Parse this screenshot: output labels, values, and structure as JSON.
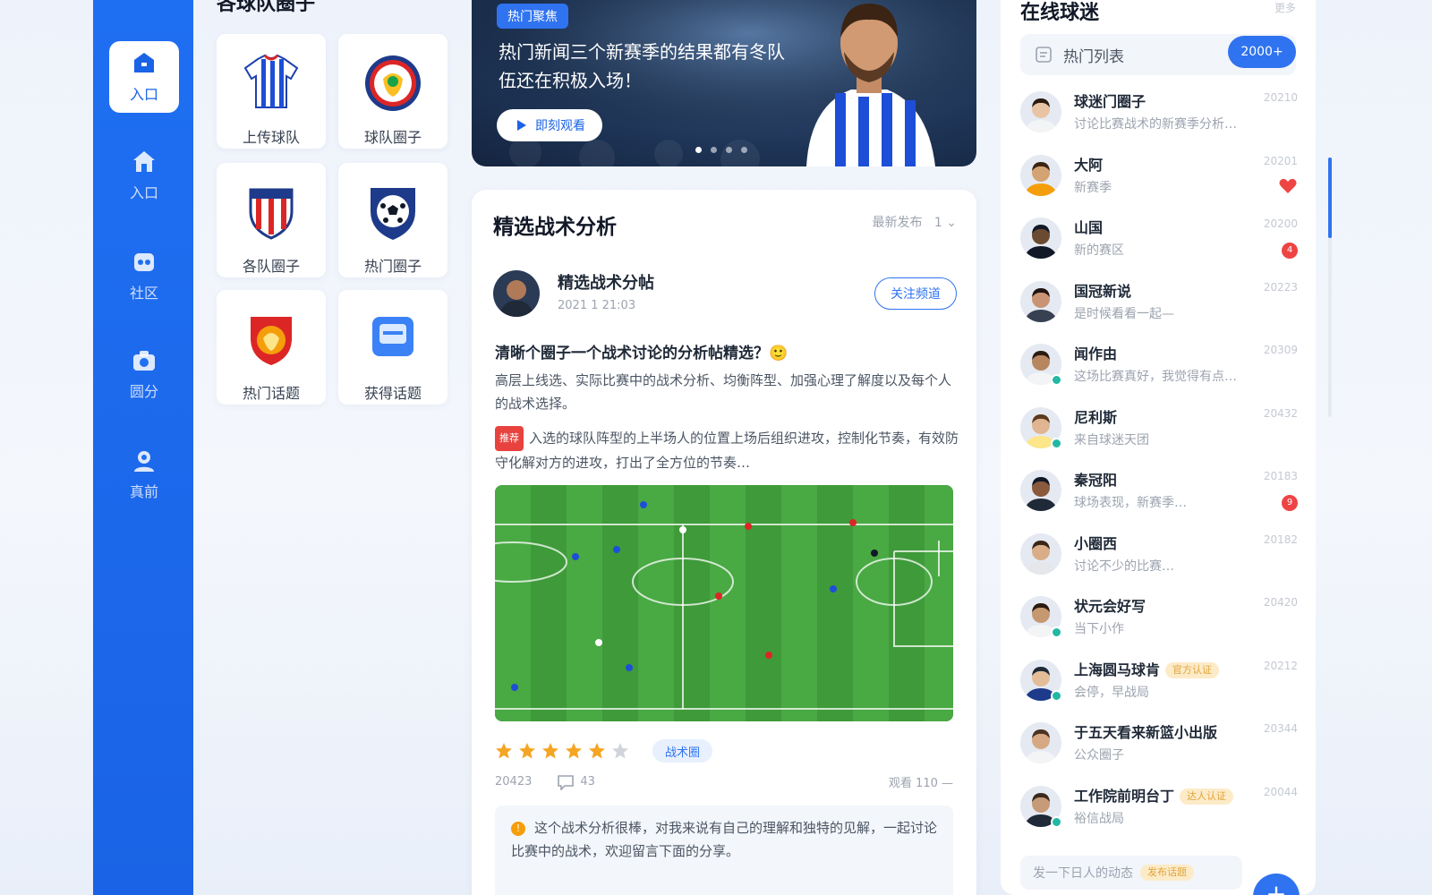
{
  "sidebar": {
    "items": [
      {
        "label": "入口",
        "icon": "home-badge-icon",
        "active": true
      },
      {
        "label": "入口",
        "icon": "house-icon",
        "active": false
      },
      {
        "label": "社区",
        "icon": "community-icon",
        "active": false
      },
      {
        "label": "圆分",
        "icon": "camera-icon",
        "active": false
      },
      {
        "label": "真前",
        "icon": "user-icon",
        "active": false
      }
    ]
  },
  "circles": {
    "title": "各球队圈子",
    "items": [
      {
        "label": "上传球队",
        "icon": "jersey-icon"
      },
      {
        "label": "球队圈子",
        "icon": "club-badge-icon"
      },
      {
        "label": "各队圈子",
        "icon": "crest-icon"
      },
      {
        "label": "热门圈子",
        "icon": "ball-shield-icon"
      },
      {
        "label": "热门话题",
        "icon": "trophy-badge-icon"
      },
      {
        "label": "获得话题",
        "icon": "chat-icon"
      }
    ]
  },
  "banner": {
    "tag": "热门聚焦",
    "text": "热门新闻三个新赛季的结果都有冬队伍还在积极入场！",
    "button": "即刻观看",
    "dots": 4,
    "active_dot": 0
  },
  "feed": {
    "title": "精选战术分析",
    "sort": "最新发布",
    "sort_value": "1",
    "post": {
      "author": "精选战术分帖",
      "time": "2021 1 21:03",
      "follow": "关注频道",
      "headline": "清晰个圈子一个战术讨论的分析帖精选？🙂",
      "body": "高层上线选、实际比赛中的战术分析、均衡阵型、加强心理了解度以及每个人的战术选择。",
      "quote_badge": "推荐",
      "quote": "入选的球队阵型的上半场人的位置上场后组织进攻，控制化节奏，有效防守化解对方的进攻，打出了全方位的节奏…",
      "rating": 5,
      "rating_max": 6,
      "tag": "战术圈",
      "date": "20423",
      "likes": "43",
      "views": "观看 110 —",
      "note": "这个战术分析很棒，对我来说有自己的理解和独特的见解，一起讨论比赛中的战术，欢迎留言下面的分享。"
    }
  },
  "online": {
    "title": "在线球迷",
    "more": "更多",
    "search_label": "热门列表",
    "search_button": "2000+",
    "users": [
      {
        "name": "球迷门圈子",
        "msg": "讨论比赛战术的新赛季分析…",
        "time": "20210",
        "online": false,
        "badge": "",
        "heart": false
      },
      {
        "name": "大阿",
        "msg": "新赛季",
        "time": "20201",
        "online": false,
        "badge": "",
        "heart": true
      },
      {
        "name": "山国",
        "msg": "新的赛区",
        "time": "20200",
        "online": false,
        "badge": "4",
        "heart": false
      },
      {
        "name": "国冠新说",
        "msg": "是时候看看一起—",
        "time": "20223",
        "online": false,
        "badge": "",
        "heart": false
      },
      {
        "name": "闻作由",
        "msg": "这场比赛真好，我觉得有点…",
        "time": "20309",
        "online": true,
        "badge": "",
        "heart": false
      },
      {
        "name": "尼利斯",
        "msg": "来自球迷天团",
        "time": "20432",
        "online": true,
        "badge": "",
        "heart": false
      },
      {
        "name": "秦冠阳",
        "msg": "球场表现，新赛季…",
        "time": "20183",
        "online": false,
        "badge": "9",
        "heart": false
      },
      {
        "name": "小圈西",
        "msg": "讨论不少的比赛…",
        "time": "20182",
        "online": false,
        "badge": "",
        "heart": false
      },
      {
        "name": "状元会好写",
        "msg": "当下小作",
        "time": "20420",
        "online": true,
        "badge": "",
        "heart": false
      },
      {
        "name": "上海圆马球肯",
        "msg": "会停，早战局",
        "time": "20212",
        "online": true,
        "badge": "",
        "heart": false,
        "tag": "官方认证"
      },
      {
        "name": "于五天看来新篮小出版",
        "msg": "公众圈子",
        "time": "20344",
        "online": false,
        "badge": "",
        "heart": false
      },
      {
        "name": "工作院前明台丁",
        "msg": "裕信战局",
        "time": "20044",
        "online": true,
        "badge": "",
        "heart": false,
        "tag": "达人认证"
      }
    ],
    "input_placeholder": "发一下日人的动态",
    "input_tag": "发布话题"
  },
  "colors": {
    "primary": "#1f6ff2",
    "accent": "#2f73f0",
    "badge": "#ef4444",
    "online": "#22b8a4",
    "star": "#f5a524"
  }
}
